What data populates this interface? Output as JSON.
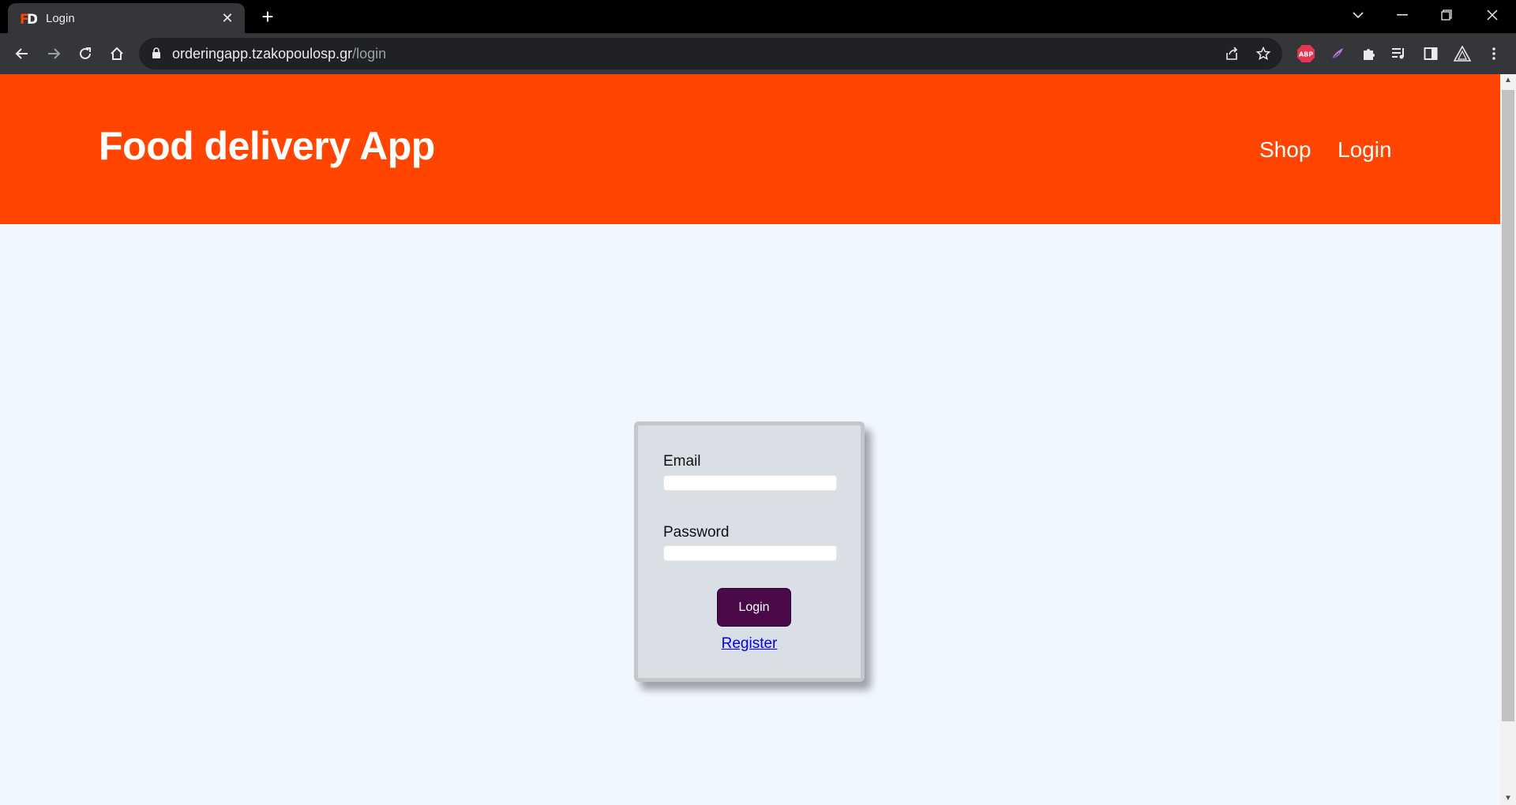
{
  "browser": {
    "tab": {
      "title": "Login",
      "favicon": "fd-logo-icon"
    },
    "url": {
      "host": "orderingapp.tzakopoulosp.gr",
      "path": "/login"
    },
    "extensions": [
      "share-icon",
      "star-icon",
      "abp-extension-icon",
      "feather-extension-icon",
      "puzzle-icon",
      "media-icon",
      "sidepanel-icon",
      "triangle-extension-icon",
      "menu-icon"
    ],
    "abp_label": "ABP"
  },
  "header": {
    "title": "Food delivery App",
    "nav": [
      {
        "label": "Shop"
      },
      {
        "label": "Login"
      }
    ]
  },
  "login_form": {
    "email_label": "Email",
    "email_value": "",
    "password_label": "Password",
    "password_value": "",
    "submit_label": "Login",
    "register_label": "Register"
  },
  "colors": {
    "header_bg": "#ff4500",
    "page_bg": "#f0f7ff",
    "card_bg": "#d9dfe5",
    "button_bg": "#4a0a4a",
    "link": "#0000ee"
  }
}
